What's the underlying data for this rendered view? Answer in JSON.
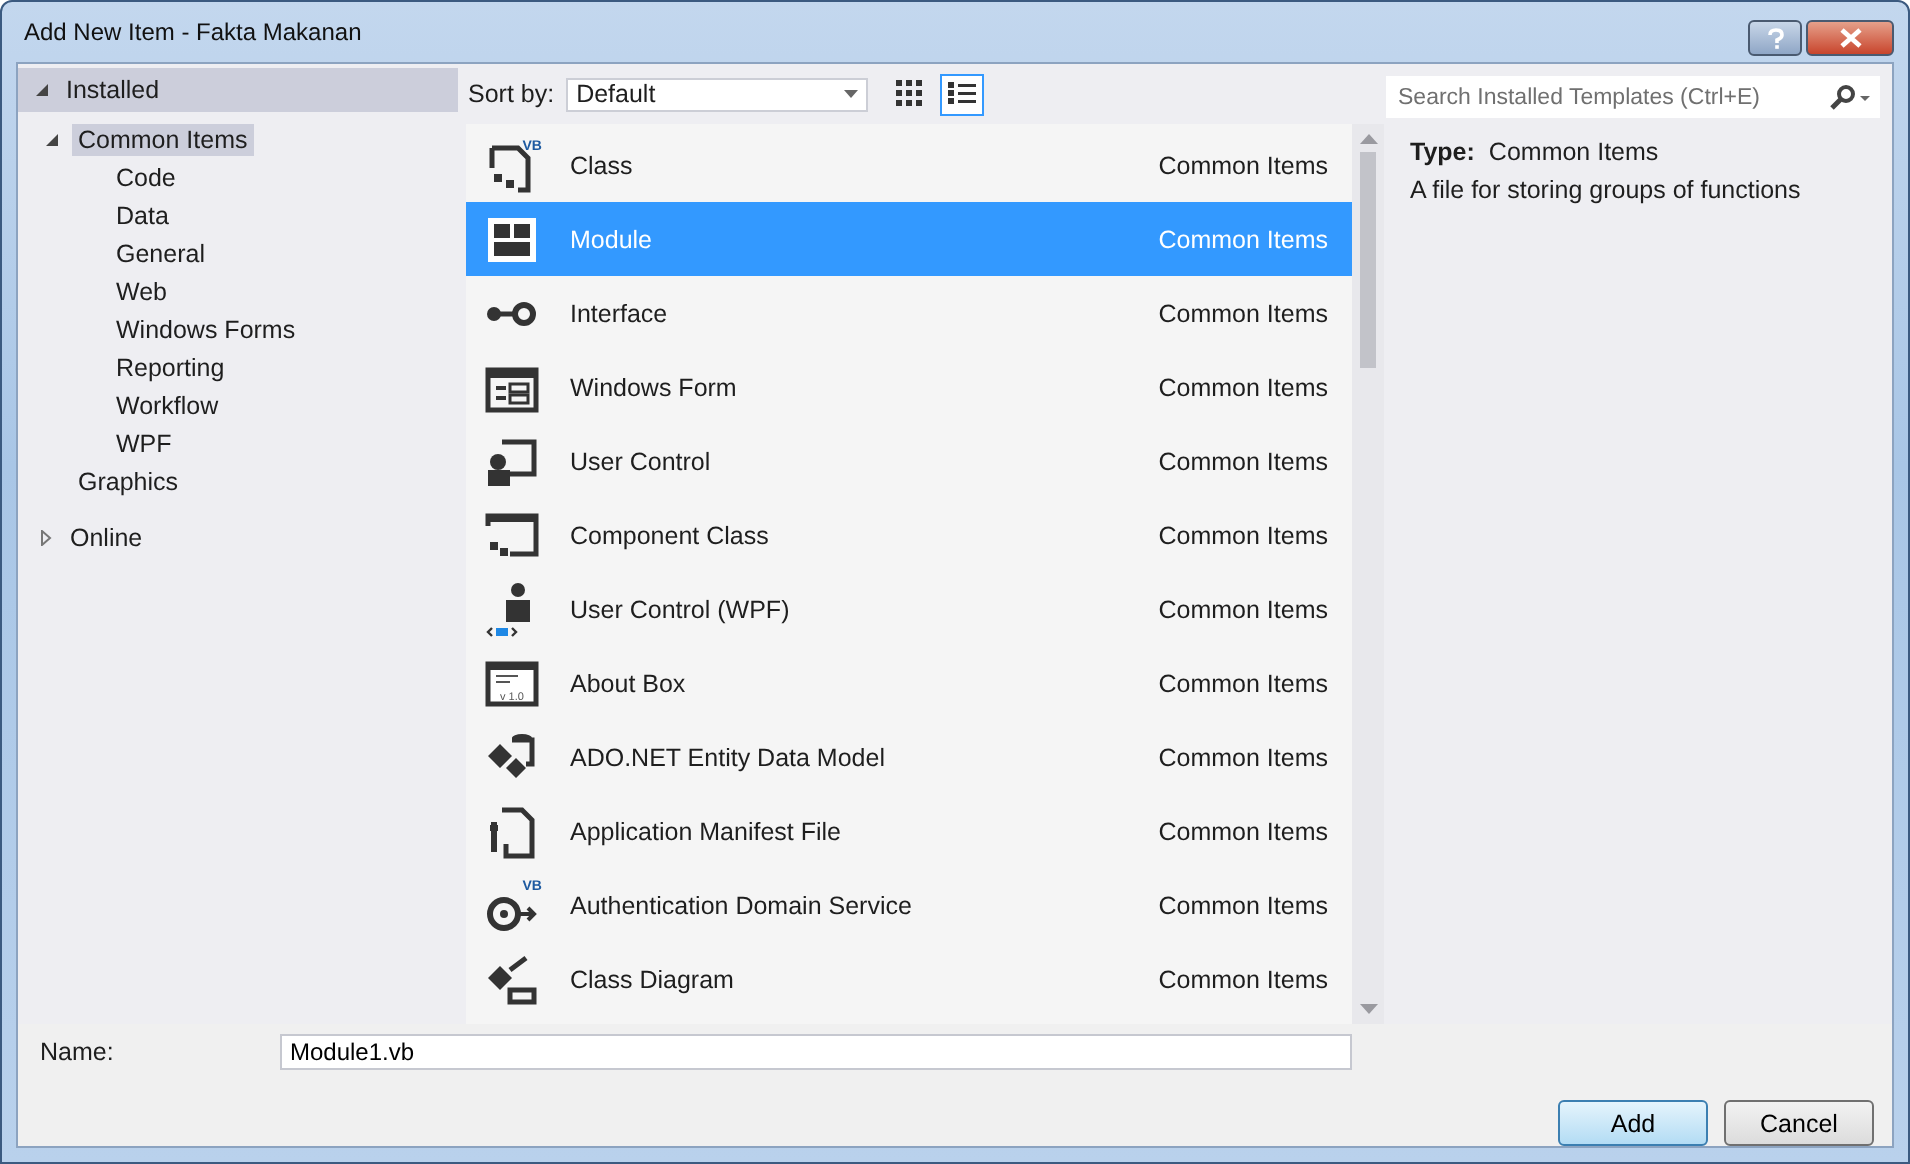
{
  "window": {
    "title": "Add New Item - Fakta Makanan"
  },
  "tree": [
    {
      "label": "Installed",
      "expanded": true,
      "selected": false,
      "children": [
        {
          "label": "Common Items",
          "expanded": true,
          "selected": true,
          "children": [
            {
              "label": "Code",
              "selected": false
            },
            {
              "label": "Data",
              "selected": false
            },
            {
              "label": "General",
              "selected": false
            },
            {
              "label": "Web",
              "selected": false
            },
            {
              "label": "Windows Forms",
              "selected": false
            },
            {
              "label": "Reporting",
              "selected": false
            },
            {
              "label": "Workflow",
              "selected": false
            },
            {
              "label": "WPF",
              "selected": false
            }
          ]
        },
        {
          "label": "Graphics",
          "selected": false
        }
      ]
    },
    {
      "label": "Online",
      "expanded": false,
      "selected": false
    }
  ],
  "toolbar": {
    "sort_label": "Sort by:",
    "sort_value": "Default",
    "view_buttons": [
      {
        "kind": "grid",
        "selected": false
      },
      {
        "kind": "list",
        "selected": true
      }
    ]
  },
  "search": {
    "placeholder": "Search Installed Templates (Ctrl+E)"
  },
  "templates": [
    {
      "name": "Class",
      "category": "Common Items",
      "selected": false,
      "icon_text": "VB"
    },
    {
      "name": "Module",
      "category": "Common Items",
      "selected": true
    },
    {
      "name": "Interface",
      "category": "Common Items",
      "selected": false
    },
    {
      "name": "Windows Form",
      "category": "Common Items",
      "selected": false
    },
    {
      "name": "User Control",
      "category": "Common Items",
      "selected": false
    },
    {
      "name": "Component Class",
      "category": "Common Items",
      "selected": false
    },
    {
      "name": "User Control (WPF)",
      "category": "Common Items",
      "selected": false
    },
    {
      "name": "About Box",
      "category": "Common Items",
      "selected": false,
      "icon_text": "v 1.0"
    },
    {
      "name": "ADO.NET Entity Data Model",
      "category": "Common Items",
      "selected": false
    },
    {
      "name": "Application Manifest File",
      "category": "Common Items",
      "selected": false
    },
    {
      "name": "Authentication Domain Service",
      "category": "Common Items",
      "selected": false,
      "icon_text": "VB"
    },
    {
      "name": "Class Diagram",
      "category": "Common Items",
      "selected": false
    }
  ],
  "details": {
    "type_label": "Type:",
    "type_value": "Common Items",
    "description": "A file for storing groups of functions"
  },
  "name_field": {
    "label": "Name:",
    "value": "Module1.vb"
  },
  "buttons": [
    {
      "label": "Add",
      "default": true
    },
    {
      "label": "Cancel",
      "default": false
    }
  ]
}
